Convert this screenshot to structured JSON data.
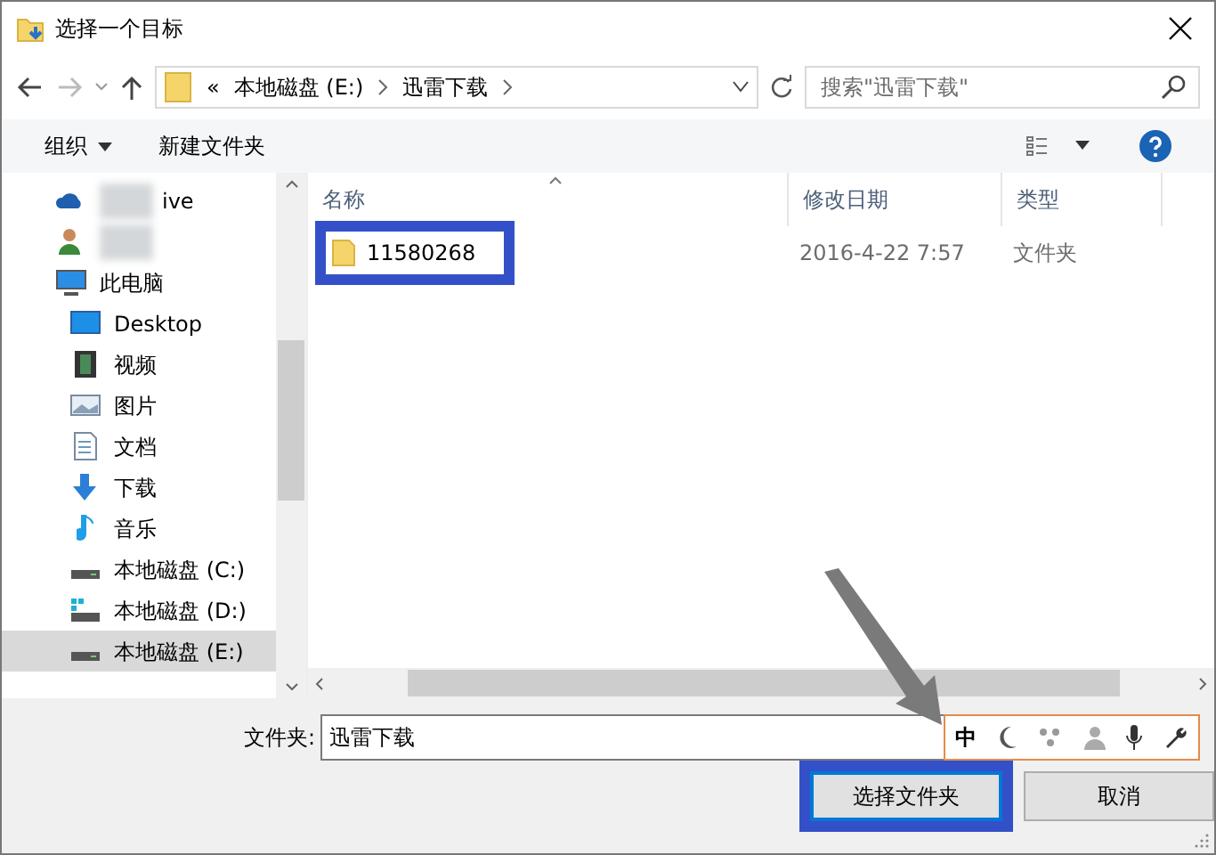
{
  "window": {
    "title": "选择一个目标"
  },
  "address": {
    "overflow": "«",
    "crumbs": [
      "本地磁盘 (E:)",
      "迅雷下载"
    ],
    "search_placeholder": "搜索\"迅雷下载\""
  },
  "toolbar": {
    "organize": "组织",
    "new_folder": "新建文件夹"
  },
  "sidebar": {
    "items": [
      {
        "kind": "cloud",
        "label": "ive",
        "selected": false,
        "blurred": true
      },
      {
        "kind": "user",
        "selected": false,
        "blurred": true
      },
      {
        "kind": "pc",
        "label": "此电脑",
        "selected": false,
        "children": [
          {
            "kind": "desktop",
            "label": "Desktop",
            "selected": false
          },
          {
            "kind": "video",
            "label": "视频",
            "selected": false
          },
          {
            "kind": "picture",
            "label": "图片",
            "selected": false
          },
          {
            "kind": "document",
            "label": "文档",
            "selected": false
          },
          {
            "kind": "download",
            "label": "下载",
            "selected": false
          },
          {
            "kind": "music",
            "label": "音乐",
            "selected": false
          },
          {
            "kind": "drive",
            "label": "本地磁盘 (C:)",
            "selected": false
          },
          {
            "kind": "drive-win",
            "label": "本地磁盘 (D:)",
            "selected": false
          },
          {
            "kind": "drive",
            "label": "本地磁盘 (E:)",
            "selected": true
          }
        ]
      }
    ]
  },
  "table": {
    "columns": [
      "名称",
      "修改日期",
      "类型"
    ],
    "rows": [
      {
        "name": "11580268",
        "date": "2016-4-22 7:57",
        "type": "文件夹",
        "highlighted": true
      }
    ]
  },
  "footer": {
    "label": "文件夹:",
    "value": "迅雷下载",
    "ime": "中",
    "buttons": [
      {
        "label": "选择文件夹",
        "kind": "primary",
        "highlighted": true
      },
      {
        "label": "取消",
        "kind": "secondary",
        "highlighted": false
      }
    ]
  },
  "annotation_arrow": true
}
